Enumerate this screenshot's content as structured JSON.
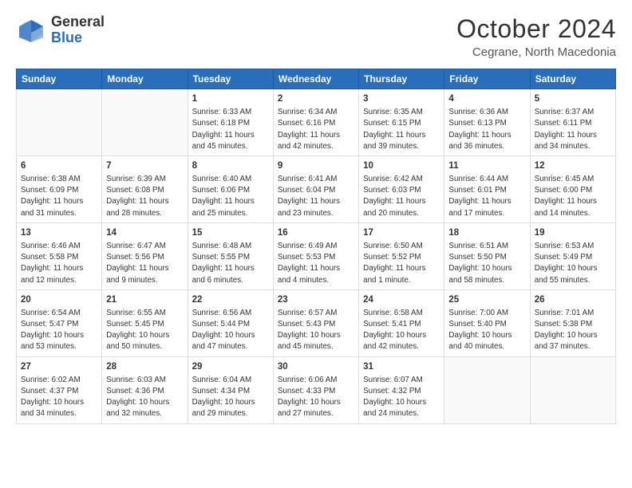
{
  "header": {
    "logo_general": "General",
    "logo_blue": "Blue",
    "title": "October 2024",
    "subtitle": "Cegrane, North Macedonia"
  },
  "weekdays": [
    "Sunday",
    "Monday",
    "Tuesday",
    "Wednesday",
    "Thursday",
    "Friday",
    "Saturday"
  ],
  "weeks": [
    [
      {
        "day": "",
        "info": ""
      },
      {
        "day": "",
        "info": ""
      },
      {
        "day": "1",
        "info": "Sunrise: 6:33 AM\nSunset: 6:18 PM\nDaylight: 11 hours and 45 minutes."
      },
      {
        "day": "2",
        "info": "Sunrise: 6:34 AM\nSunset: 6:16 PM\nDaylight: 11 hours and 42 minutes."
      },
      {
        "day": "3",
        "info": "Sunrise: 6:35 AM\nSunset: 6:15 PM\nDaylight: 11 hours and 39 minutes."
      },
      {
        "day": "4",
        "info": "Sunrise: 6:36 AM\nSunset: 6:13 PM\nDaylight: 11 hours and 36 minutes."
      },
      {
        "day": "5",
        "info": "Sunrise: 6:37 AM\nSunset: 6:11 PM\nDaylight: 11 hours and 34 minutes."
      }
    ],
    [
      {
        "day": "6",
        "info": "Sunrise: 6:38 AM\nSunset: 6:09 PM\nDaylight: 11 hours and 31 minutes."
      },
      {
        "day": "7",
        "info": "Sunrise: 6:39 AM\nSunset: 6:08 PM\nDaylight: 11 hours and 28 minutes."
      },
      {
        "day": "8",
        "info": "Sunrise: 6:40 AM\nSunset: 6:06 PM\nDaylight: 11 hours and 25 minutes."
      },
      {
        "day": "9",
        "info": "Sunrise: 6:41 AM\nSunset: 6:04 PM\nDaylight: 11 hours and 23 minutes."
      },
      {
        "day": "10",
        "info": "Sunrise: 6:42 AM\nSunset: 6:03 PM\nDaylight: 11 hours and 20 minutes."
      },
      {
        "day": "11",
        "info": "Sunrise: 6:44 AM\nSunset: 6:01 PM\nDaylight: 11 hours and 17 minutes."
      },
      {
        "day": "12",
        "info": "Sunrise: 6:45 AM\nSunset: 6:00 PM\nDaylight: 11 hours and 14 minutes."
      }
    ],
    [
      {
        "day": "13",
        "info": "Sunrise: 6:46 AM\nSunset: 5:58 PM\nDaylight: 11 hours and 12 minutes."
      },
      {
        "day": "14",
        "info": "Sunrise: 6:47 AM\nSunset: 5:56 PM\nDaylight: 11 hours and 9 minutes."
      },
      {
        "day": "15",
        "info": "Sunrise: 6:48 AM\nSunset: 5:55 PM\nDaylight: 11 hours and 6 minutes."
      },
      {
        "day": "16",
        "info": "Sunrise: 6:49 AM\nSunset: 5:53 PM\nDaylight: 11 hours and 4 minutes."
      },
      {
        "day": "17",
        "info": "Sunrise: 6:50 AM\nSunset: 5:52 PM\nDaylight: 11 hours and 1 minute."
      },
      {
        "day": "18",
        "info": "Sunrise: 6:51 AM\nSunset: 5:50 PM\nDaylight: 10 hours and 58 minutes."
      },
      {
        "day": "19",
        "info": "Sunrise: 6:53 AM\nSunset: 5:49 PM\nDaylight: 10 hours and 55 minutes."
      }
    ],
    [
      {
        "day": "20",
        "info": "Sunrise: 6:54 AM\nSunset: 5:47 PM\nDaylight: 10 hours and 53 minutes."
      },
      {
        "day": "21",
        "info": "Sunrise: 6:55 AM\nSunset: 5:45 PM\nDaylight: 10 hours and 50 minutes."
      },
      {
        "day": "22",
        "info": "Sunrise: 6:56 AM\nSunset: 5:44 PM\nDaylight: 10 hours and 47 minutes."
      },
      {
        "day": "23",
        "info": "Sunrise: 6:57 AM\nSunset: 5:43 PM\nDaylight: 10 hours and 45 minutes."
      },
      {
        "day": "24",
        "info": "Sunrise: 6:58 AM\nSunset: 5:41 PM\nDaylight: 10 hours and 42 minutes."
      },
      {
        "day": "25",
        "info": "Sunrise: 7:00 AM\nSunset: 5:40 PM\nDaylight: 10 hours and 40 minutes."
      },
      {
        "day": "26",
        "info": "Sunrise: 7:01 AM\nSunset: 5:38 PM\nDaylight: 10 hours and 37 minutes."
      }
    ],
    [
      {
        "day": "27",
        "info": "Sunrise: 6:02 AM\nSunset: 4:37 PM\nDaylight: 10 hours and 34 minutes."
      },
      {
        "day": "28",
        "info": "Sunrise: 6:03 AM\nSunset: 4:36 PM\nDaylight: 10 hours and 32 minutes."
      },
      {
        "day": "29",
        "info": "Sunrise: 6:04 AM\nSunset: 4:34 PM\nDaylight: 10 hours and 29 minutes."
      },
      {
        "day": "30",
        "info": "Sunrise: 6:06 AM\nSunset: 4:33 PM\nDaylight: 10 hours and 27 minutes."
      },
      {
        "day": "31",
        "info": "Sunrise: 6:07 AM\nSunset: 4:32 PM\nDaylight: 10 hours and 24 minutes."
      },
      {
        "day": "",
        "info": ""
      },
      {
        "day": "",
        "info": ""
      }
    ]
  ]
}
